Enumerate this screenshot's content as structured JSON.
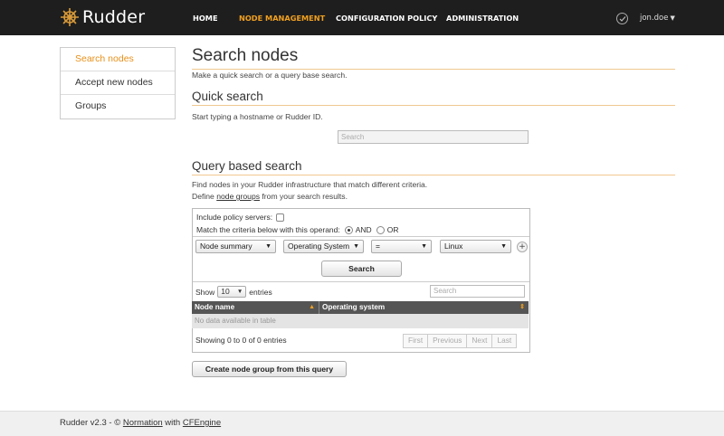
{
  "brand": {
    "name": "Rudder",
    "icon": "ship-wheel-icon"
  },
  "nav": {
    "items": [
      {
        "label": "HOME"
      },
      {
        "label": "NODE MANAGEMENT",
        "active": true
      },
      {
        "label": "CONFIGURATION POLICY"
      },
      {
        "label": "ADMINISTRATION"
      }
    ],
    "status_icon": "check-circle-icon",
    "user": "jon.doe"
  },
  "sidebar": {
    "items": [
      {
        "label": "Search nodes",
        "active": true
      },
      {
        "label": "Accept new nodes"
      },
      {
        "label": "Groups"
      }
    ]
  },
  "main": {
    "title": "Search nodes",
    "intro": "Make a quick search or a query base search.",
    "quick": {
      "heading": "Quick search",
      "hint": "Start typing a hostname or Rudder ID.",
      "placeholder": "Search"
    },
    "query": {
      "heading": "Query based search",
      "desc1": "Find nodes in your Rudder infrastructure that match different criteria.",
      "desc2_pre": "Define ",
      "desc2_link": "node groups",
      "desc2_post": " from your search results.",
      "include_label": "Include policy servers:",
      "operand_label": "Match the criteria below with this operand:",
      "and_label": "AND",
      "or_label": "OR",
      "criteria": {
        "object": "Node summary",
        "attribute": "Operating System",
        "comparator": "=",
        "value": "Linux"
      },
      "search_button": "Search"
    },
    "results": {
      "show_label": "Show",
      "page_size": "10",
      "entries_label": "entries",
      "search_placeholder": "Search",
      "columns": [
        "Node name",
        "Operating system"
      ],
      "empty": "No data available in table",
      "info": "Showing 0 to 0 of 0 entries",
      "pager": [
        "First",
        "Previous",
        "Next",
        "Last"
      ]
    },
    "create_group_button": "Create node group from this query"
  },
  "footer": {
    "prefix": "Rudder v2.3 - © ",
    "link1": "Normation",
    "middle": " with ",
    "link2": "CFEngine"
  }
}
